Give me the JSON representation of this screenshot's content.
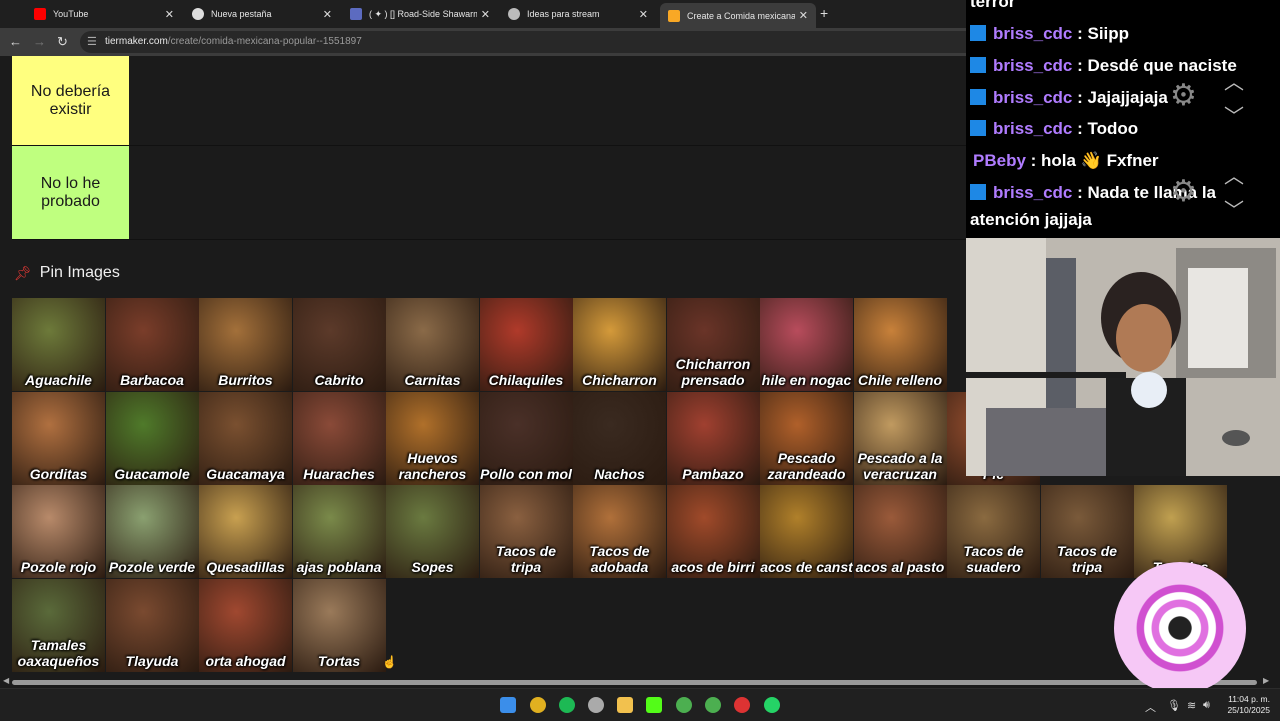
{
  "browser": {
    "tabs": [
      {
        "title": "YouTube"
      },
      {
        "title": "Nueva pestaña"
      },
      {
        "title": "( ✦ ) [] Road-Side Shawarma [|"
      },
      {
        "title": "Ideas para stream"
      },
      {
        "title": "Create a Comida mexicana (po|"
      }
    ],
    "url_domain": "tiermaker.com",
    "url_path": "/create/comida-mexicana-popular--1551897"
  },
  "tiers": [
    {
      "label": "No debería existir",
      "color": "#ffff7f"
    },
    {
      "label": "No lo he probado",
      "color": "#bfff7f"
    }
  ],
  "pin_images_heading": "Pin Images",
  "foods": [
    "Aguachile",
    "Barbacoa",
    "Burritos",
    "Cabrito",
    "Carnitas",
    "Chilaquiles",
    "Chicharron",
    "Chicharron prensado",
    "hile en nogac",
    "Chile relleno",
    "Gorditas",
    "Guacamole",
    "Guacamaya",
    "Huaraches",
    "Huevos rancheros",
    "Pollo con mol",
    "Nachos",
    "Pambazo",
    "Pescado zarandeado",
    "Pescado a la veracruzan",
    "Pic",
    "Pozole rojo",
    "Pozole verde",
    "Quesadillas",
    "ajas poblana",
    "Sopes",
    "Tacos de tripa",
    "Tacos de adobada",
    "acos de birri",
    "acos de canst",
    "acos al pasto",
    "Tacos de suadero",
    "Tacos de tripa",
    "Tamales",
    "Tamales oaxaqueños",
    "Tlayuda",
    "orta ahogad",
    "Tortas"
  ],
  "chat": [
    {
      "user": "",
      "text": "terror"
    },
    {
      "user": "briss_cdc",
      "text": " : Siipp"
    },
    {
      "user": "briss_cdc",
      "text": " : Desdé que naciste"
    },
    {
      "user": "briss_cdc",
      "text": " : Jajajjajaja"
    },
    {
      "user": "briss_cdc",
      "text": " : Todoo"
    },
    {
      "user": "PBeby",
      "text": " : hola 👋 Fxfner"
    },
    {
      "user": "briss_cdc",
      "text": " : Nada te llama la"
    },
    {
      "user": "",
      "text": "atención jajjaja"
    }
  ],
  "clock": {
    "time": "11:04 p. m.",
    "date": "25/10/2025"
  }
}
